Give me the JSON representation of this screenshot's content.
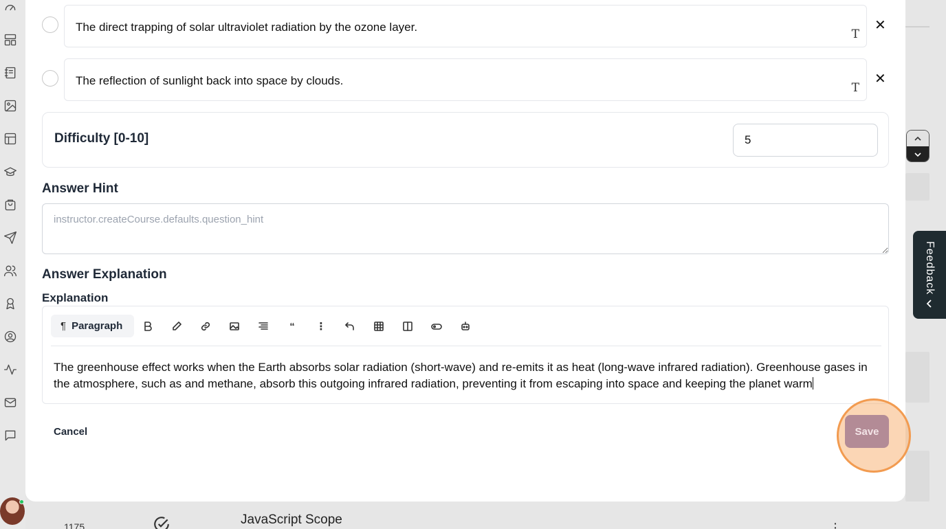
{
  "options": [
    {
      "text": "The direct trapping of solar ultraviolet radiation by the ozone layer.",
      "format_icon": "T",
      "remove_icon": "✕"
    },
    {
      "text": "The reflection of sunlight back into space by clouds.",
      "format_icon": "T",
      "remove_icon": "✕"
    }
  ],
  "difficulty": {
    "label": "Difficulty [0-10]",
    "value": "5"
  },
  "answer_hint": {
    "title": "Answer Hint",
    "placeholder": "instructor.createCourse.defaults.question_hint"
  },
  "answer_explanation": {
    "title": "Answer Explanation",
    "field_label": "Explanation",
    "toolbar": {
      "paragraph_label": "Paragraph",
      "paragraph_icon": "¶"
    },
    "text": "The greenhouse effect works when the Earth absorbs solar radiation (short-wave) and re-emits it as heat (long-wave infrared radiation). Greenhouse gases in the atmosphere, such as and methane, absorb this outgoing infrared radiation, preventing it from escaping into space and keeping the planet warm"
  },
  "actions": {
    "cancel_label": "Cancel",
    "save_label": "Save"
  },
  "background": {
    "feedback_label": "Feedback",
    "row_id": "1175",
    "row_title": "JavaScript Scope",
    "row_menu": "⋮"
  },
  "colors": {
    "save_button": "#b38b96",
    "highlight_ring": "#f29b50",
    "feedback_tab": "#1f2b30"
  }
}
